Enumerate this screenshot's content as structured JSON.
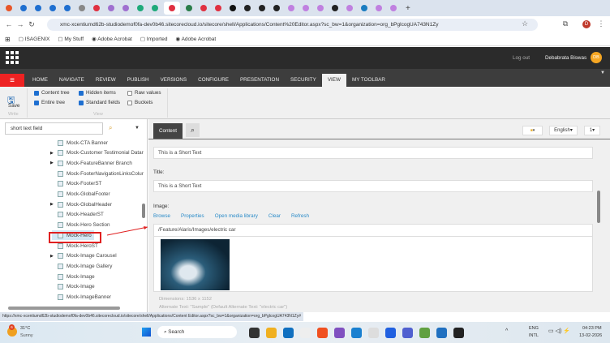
{
  "browser": {
    "url": "xmc-xcentiumd62b-studiodemof0fa-dev0b46.sitecorecloud.io/sitecore/shell/Applications/Content%20Editor.aspx?sc_bw=1&organization=org_bPglcogUA743N1Zy",
    "new_tab": "+",
    "profile_initial": "D",
    "tab_colors": [
      "#e8562a",
      "#1f6fd0",
      "#1f6fd0",
      "#1f6fd0",
      "#1f6fd0",
      "#888",
      "#e03040",
      "#a070d0",
      "#a070d0",
      "#1faa7a",
      "#1faa7a",
      "#e03040",
      "#2a7d4a",
      "#e03040",
      "#e03040",
      "#111",
      "#222",
      "#222",
      "#222",
      "#c080e0",
      "#c080e0",
      "#c080e0",
      "#222",
      "#c080e0",
      "#1a7cc0",
      "#c080e0",
      "#c080e0"
    ],
    "bookmarks": [
      "ISAGENIX",
      "My Stuff",
      "Adobe Acrobat",
      "Imported",
      "Adobe Acrobat"
    ]
  },
  "header": {
    "logout": "Log out",
    "user": "Debabrata Biswas",
    "avatar": "DB"
  },
  "ribbon": {
    "tabs": [
      "HOME",
      "NAVIGATE",
      "REVIEW",
      "PUBLISH",
      "VERSIONS",
      "CONFIGURE",
      "PRESENTATION",
      "SECURITY",
      "VIEW",
      "MY TOOLBAR"
    ],
    "selected": "VIEW",
    "save": "Save",
    "write_group": "Write",
    "view_group": "View",
    "checks": [
      {
        "label": "Content tree",
        "checked": true
      },
      {
        "label": "Entire tree",
        "checked": true
      },
      {
        "label": "Hidden items",
        "checked": true
      },
      {
        "label": "Standard fields",
        "checked": true
      },
      {
        "label": "Raw values",
        "checked": false
      },
      {
        "label": "Buckets",
        "checked": false
      }
    ]
  },
  "tree": {
    "search": "short text field",
    "items": [
      {
        "label": "Mock-CTA Banner",
        "expandable": false
      },
      {
        "label": "Mock-Customer Testimonial Datar",
        "expandable": true
      },
      {
        "label": "Mock-FeatureBanner Branch",
        "expandable": true
      },
      {
        "label": "Mock-FooterNavigationLinksColur",
        "expandable": false
      },
      {
        "label": "Mock-FooterST",
        "expandable": false
      },
      {
        "label": "Mock-GlobalFooter",
        "expandable": false
      },
      {
        "label": "Mock-GlobalHeader",
        "expandable": true
      },
      {
        "label": "Mock-HeaderST",
        "expandable": false
      },
      {
        "label": "Mock-Hero Section",
        "expandable": false
      },
      {
        "label": "Mock-Hero",
        "expandable": false,
        "selected": true
      },
      {
        "label": "Mock-HeroST",
        "expandable": false
      },
      {
        "label": "Mock-Image Carousel",
        "expandable": true
      },
      {
        "label": "Mock-Image Gallery",
        "expandable": false
      },
      {
        "label": "Mock-Image",
        "expandable": false
      },
      {
        "label": "Mock-Image",
        "expandable": false
      },
      {
        "label": "Mock-ImageBanner",
        "expandable": false
      }
    ]
  },
  "editor": {
    "tab_content": "Content",
    "language": "English",
    "version": "1",
    "field1_value": "This is a Short Text",
    "title_label": "Title:",
    "title_value": "This is a Short Text",
    "image_label": "Image:",
    "image_actions": [
      "Browse",
      "Properties",
      "Open media library",
      "Clear",
      "Refresh"
    ],
    "image_path": "/Feature/Alaris/Images/electric car",
    "dimensions": "Dimensions: 1536 x 1152",
    "alt_text": "Alternate Text: \"Sample\" (Default Alternate Text: \"electric car\")"
  },
  "status_url": "https://xmc-xcentiumd62b-studiodemof0fa-dev0b46.sitecorecloud.io/sitecore/shell/Applications/Content Editor.aspx?sc_bw=1&organization=org_bPglcogUA743N1Zy#",
  "taskbar": {
    "temp": "31°C",
    "weather": "Sunny",
    "weather_badge": "6",
    "search": "Search",
    "lang1": "ENG",
    "lang2": "INTL",
    "time": "04:23 PM",
    "date": "13-02-2026"
  }
}
